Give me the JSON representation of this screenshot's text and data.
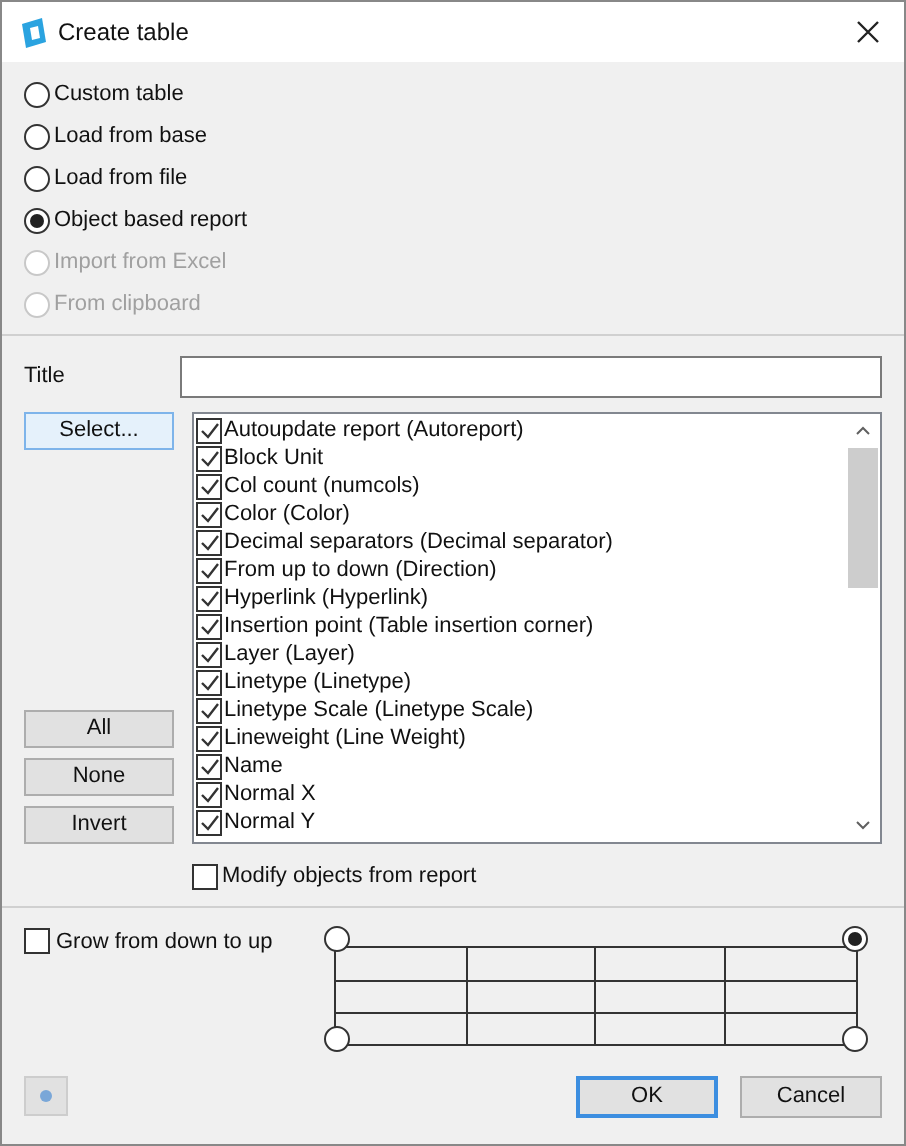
{
  "window": {
    "title": "Create table"
  },
  "source_options": [
    {
      "label": "Custom table",
      "selected": false,
      "disabled": false
    },
    {
      "label": "Load from base",
      "selected": false,
      "disabled": false
    },
    {
      "label": "Load from file",
      "selected": false,
      "disabled": false
    },
    {
      "label": "Object based report",
      "selected": true,
      "disabled": false
    },
    {
      "label": "Import from Excel",
      "selected": false,
      "disabled": true
    },
    {
      "label": "From clipboard",
      "selected": false,
      "disabled": true
    }
  ],
  "title_field": {
    "label": "Title"
  },
  "select_button": "Select...",
  "properties": [
    {
      "label": "Autoupdate report (Autoreport)",
      "checked": true
    },
    {
      "label": "Block Unit",
      "checked": true
    },
    {
      "label": "Col count (numcols)",
      "checked": true
    },
    {
      "label": "Color (Color)",
      "checked": true
    },
    {
      "label": "Decimal separators (Decimal separator)",
      "checked": true
    },
    {
      "label": "From up to down (Direction)",
      "checked": true
    },
    {
      "label": "Hyperlink (Hyperlink)",
      "checked": true
    },
    {
      "label": "Insertion point (Table insertion corner)",
      "checked": true
    },
    {
      "label": "Layer (Layer)",
      "checked": true
    },
    {
      "label": "Linetype (Linetype)",
      "checked": true
    },
    {
      "label": "Linetype Scale (Linetype Scale)",
      "checked": true
    },
    {
      "label": "Lineweight (Line Weight)",
      "checked": true
    },
    {
      "label": "Name",
      "checked": true
    },
    {
      "label": "Normal X",
      "checked": true
    },
    {
      "label": "Normal Y",
      "checked": true
    }
  ],
  "selection_buttons": [
    "All",
    "None",
    "Invert"
  ],
  "modify_objects": {
    "label": "Modify objects from report",
    "checked": false
  },
  "grow_from_down": {
    "label": "Grow from down to up",
    "checked": false
  },
  "insertion_corners": [
    {
      "selected": false
    },
    {
      "selected": true
    },
    {
      "selected": false
    },
    {
      "selected": false
    }
  ],
  "buttons": [
    {
      "label": "OK",
      "kind": "default"
    },
    {
      "label": "Cancel",
      "kind": "normal"
    }
  ]
}
